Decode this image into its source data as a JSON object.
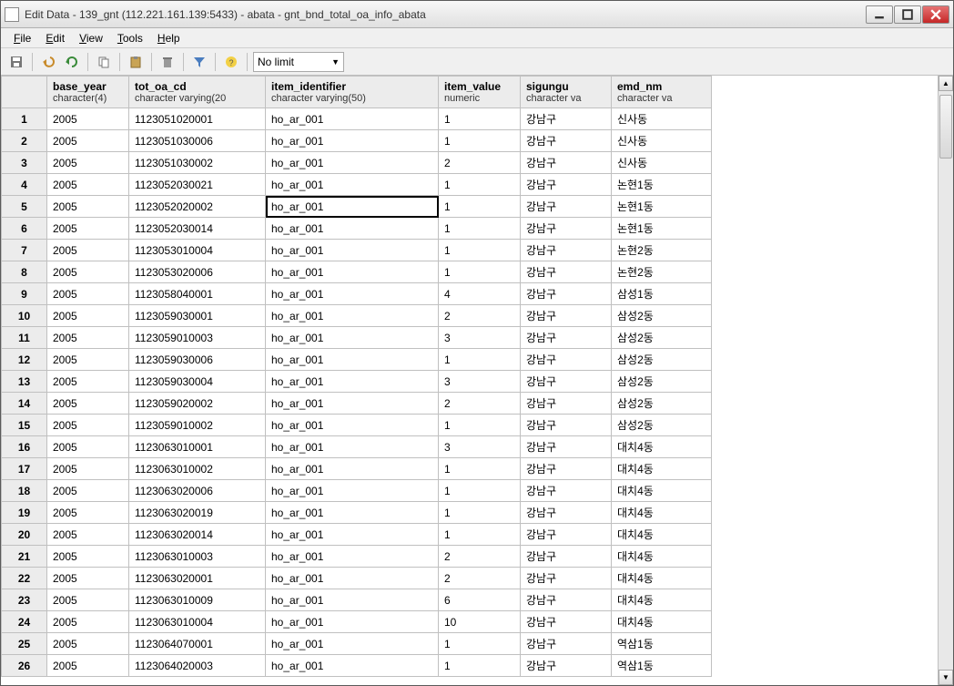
{
  "window": {
    "title": "Edit Data - 139_gnt (112.221.161.139:5433) - abata - gnt_bnd_total_oa_info_abata"
  },
  "menubar": {
    "items": [
      {
        "label": "File",
        "accel": "F"
      },
      {
        "label": "Edit",
        "accel": "E"
      },
      {
        "label": "View",
        "accel": "V"
      },
      {
        "label": "Tools",
        "accel": "T"
      },
      {
        "label": "Help",
        "accel": "H"
      }
    ]
  },
  "toolbar": {
    "limit_label": "No limit"
  },
  "columns": [
    {
      "name": "base_year",
      "type": "character(4)"
    },
    {
      "name": "tot_oa_cd",
      "type": "character varying(20"
    },
    {
      "name": "item_identifier",
      "type": "character varying(50)"
    },
    {
      "name": "item_value",
      "type": "numeric"
    },
    {
      "name": "sigungu",
      "type": "character va"
    },
    {
      "name": "emd_nm",
      "type": "character va"
    }
  ],
  "selected_cell": {
    "row": 5,
    "col": 2
  },
  "rows": [
    [
      "2005",
      "1123051020001",
      "ho_ar_001",
      "1",
      "강남구",
      "신사동"
    ],
    [
      "2005",
      "1123051030006",
      "ho_ar_001",
      "1",
      "강남구",
      "신사동"
    ],
    [
      "2005",
      "1123051030002",
      "ho_ar_001",
      "2",
      "강남구",
      "신사동"
    ],
    [
      "2005",
      "1123052030021",
      "ho_ar_001",
      "1",
      "강남구",
      "논현1동"
    ],
    [
      "2005",
      "1123052020002",
      "ho_ar_001",
      "1",
      "강남구",
      "논현1동"
    ],
    [
      "2005",
      "1123052030014",
      "ho_ar_001",
      "1",
      "강남구",
      "논현1동"
    ],
    [
      "2005",
      "1123053010004",
      "ho_ar_001",
      "1",
      "강남구",
      "논현2동"
    ],
    [
      "2005",
      "1123053020006",
      "ho_ar_001",
      "1",
      "강남구",
      "논현2동"
    ],
    [
      "2005",
      "1123058040001",
      "ho_ar_001",
      "4",
      "강남구",
      "삼성1동"
    ],
    [
      "2005",
      "1123059030001",
      "ho_ar_001",
      "2",
      "강남구",
      "삼성2동"
    ],
    [
      "2005",
      "1123059010003",
      "ho_ar_001",
      "3",
      "강남구",
      "삼성2동"
    ],
    [
      "2005",
      "1123059030006",
      "ho_ar_001",
      "1",
      "강남구",
      "삼성2동"
    ],
    [
      "2005",
      "1123059030004",
      "ho_ar_001",
      "3",
      "강남구",
      "삼성2동"
    ],
    [
      "2005",
      "1123059020002",
      "ho_ar_001",
      "2",
      "강남구",
      "삼성2동"
    ],
    [
      "2005",
      "1123059010002",
      "ho_ar_001",
      "1",
      "강남구",
      "삼성2동"
    ],
    [
      "2005",
      "1123063010001",
      "ho_ar_001",
      "3",
      "강남구",
      "대치4동"
    ],
    [
      "2005",
      "1123063010002",
      "ho_ar_001",
      "1",
      "강남구",
      "대치4동"
    ],
    [
      "2005",
      "1123063020006",
      "ho_ar_001",
      "1",
      "강남구",
      "대치4동"
    ],
    [
      "2005",
      "1123063020019",
      "ho_ar_001",
      "1",
      "강남구",
      "대치4동"
    ],
    [
      "2005",
      "1123063020014",
      "ho_ar_001",
      "1",
      "강남구",
      "대치4동"
    ],
    [
      "2005",
      "1123063010003",
      "ho_ar_001",
      "2",
      "강남구",
      "대치4동"
    ],
    [
      "2005",
      "1123063020001",
      "ho_ar_001",
      "2",
      "강남구",
      "대치4동"
    ],
    [
      "2005",
      "1123063010009",
      "ho_ar_001",
      "6",
      "강남구",
      "대치4동"
    ],
    [
      "2005",
      "1123063010004",
      "ho_ar_001",
      "10",
      "강남구",
      "대치4동"
    ],
    [
      "2005",
      "1123064070001",
      "ho_ar_001",
      "1",
      "강남구",
      "역삼1동"
    ],
    [
      "2005",
      "1123064020003",
      "ho_ar_001",
      "1",
      "강남구",
      "역삼1동"
    ]
  ]
}
